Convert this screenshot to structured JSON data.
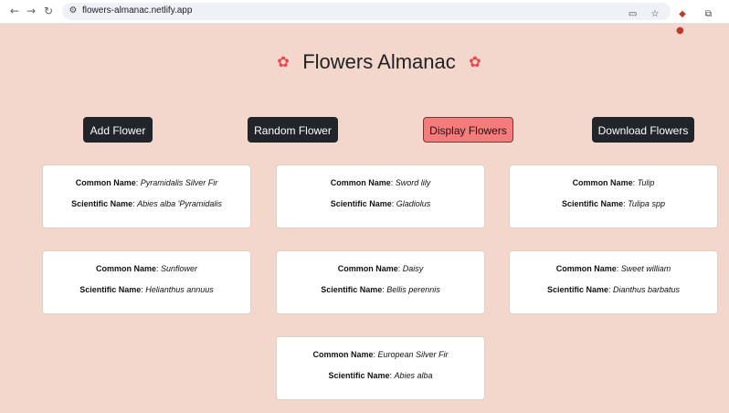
{
  "browser": {
    "url": "flowers-almanac.netlify.app"
  },
  "page": {
    "title": "Flowers Almanac"
  },
  "buttons": [
    {
      "label": "Add Flower",
      "active": false
    },
    {
      "label": "Random Flower",
      "active": false
    },
    {
      "label": "Display Flowers",
      "active": true
    },
    {
      "label": "Download Flowers",
      "active": false
    }
  ],
  "labels": {
    "common": "Common Name",
    "scientific": "Scientific Name"
  },
  "flowers": [
    {
      "common": "Pyramidalis Silver Fir",
      "scientific": "Abies alba 'Pyramidalis"
    },
    {
      "common": "Sword lily",
      "scientific": "Gladiolus"
    },
    {
      "common": "Tulip",
      "scientific": "Tulipa spp"
    },
    {
      "common": "Sunflower",
      "scientific": "Helianthus annuus"
    },
    {
      "common": "Daisy",
      "scientific": "Bellis perennis"
    },
    {
      "common": "Sweet william",
      "scientific": "Dianthus barbatus"
    },
    {
      "common": "European Silver Fir",
      "scientific": "Abies alba"
    }
  ]
}
